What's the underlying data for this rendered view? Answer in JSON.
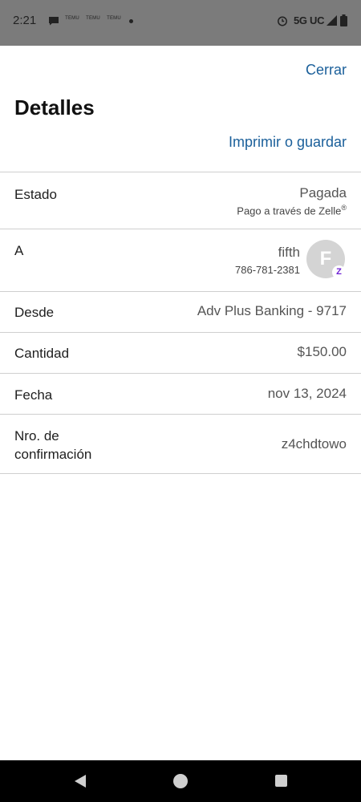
{
  "status_bar": {
    "time": "2:21",
    "temu_labels": [
      "TEMU",
      "TEMU",
      "TEMU"
    ],
    "network": "5G UC",
    "icons": [
      "chat-icon",
      "alarm-icon",
      "signal-icon",
      "battery-icon"
    ]
  },
  "header": {
    "close_label": "Cerrar",
    "title": "Detalles",
    "print_label": "Imprimir o guardar"
  },
  "details": {
    "status": {
      "label": "Estado",
      "value": "Pagada",
      "sub": "Pago a través de Zelle",
      "sub_mark": "®"
    },
    "to": {
      "label": "A",
      "name": "fifth",
      "phone": "786-781-2381",
      "avatar_letter": "F",
      "badge_letter": "Z"
    },
    "from": {
      "label": "Desde",
      "value": "Adv Plus Banking - 9717"
    },
    "amount": {
      "label": "Cantidad",
      "value": "$150.00"
    },
    "date": {
      "label": "Fecha",
      "value": "nov 13, 2024"
    },
    "confirmation": {
      "label_line1": "Nro. de",
      "label_line2": "confirmación",
      "value": "z4chdtowo"
    }
  },
  "colors": {
    "link": "#1a5f9a",
    "status_bar": "#7b7b7b",
    "zelle_purple": "#6d1ed4"
  },
  "nav_bar": {
    "icons": [
      "back-icon",
      "home-icon",
      "recent-apps-icon"
    ]
  }
}
